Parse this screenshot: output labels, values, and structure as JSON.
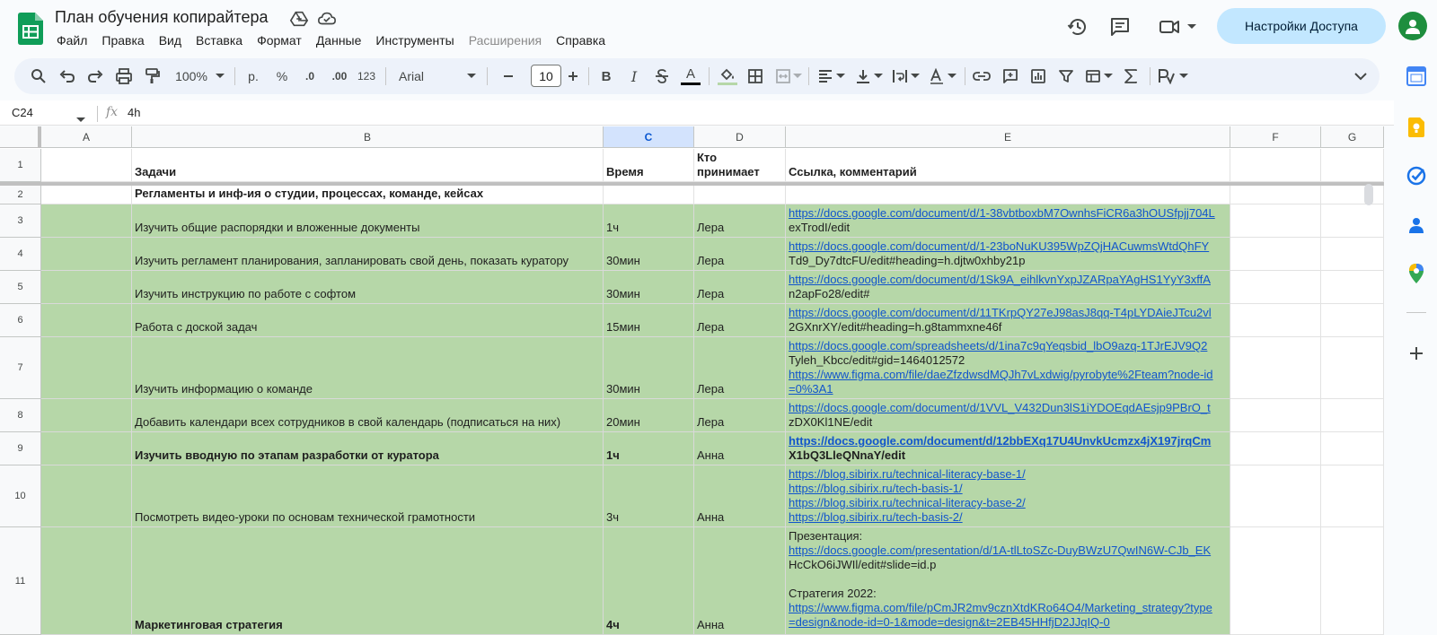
{
  "app": {
    "title": "План обучения копирайтера",
    "share_label": "Настройки Доступа",
    "accent": "#0f9d58"
  },
  "menu": [
    "Файл",
    "Правка",
    "Вид",
    "Вставка",
    "Формат",
    "Данные",
    "Инструменты",
    "Расширения",
    "Справка"
  ],
  "menu_disabled": [
    "Расширения"
  ],
  "toolbar": {
    "zoom": "100%",
    "currency": "р.",
    "percent": "%",
    "dec_decrease": ".0",
    "dec_increase": ".00",
    "format_num": "123",
    "font": "Arial",
    "font_size": "10",
    "bold": "B",
    "italic": "I",
    "text_color": "A"
  },
  "formula": {
    "cell_ref": "C24",
    "fx": "fx",
    "value": "4h"
  },
  "columns": [
    "A",
    "B",
    "C",
    "D",
    "E",
    "F",
    "G"
  ],
  "selected_column": "C",
  "rows": [
    {
      "num": "1",
      "green": false,
      "bold": true,
      "b": "Задачи",
      "c": "Время",
      "d": "Кто принимает",
      "e": [
        "Ссылка, комментарий"
      ],
      "e_link": false
    },
    {
      "num": "2",
      "green": false,
      "bold": true,
      "b": "Регламенты и инф-ия о студии, процессах, команде, кейсах",
      "c": "",
      "d": "",
      "e": [],
      "e_link": false
    },
    {
      "num": "3",
      "green": true,
      "bold": false,
      "b": "Изучить общие распорядки и вложенные документы",
      "c": "1ч",
      "d": "Лера",
      "e": [
        "https://docs.google.com/document/d/1-38vbtboxbM7OwnhsFiCR6a3hOUSfpjj704L",
        "exTrodI/edit"
      ],
      "e_link": true
    },
    {
      "num": "4",
      "green": true,
      "bold": false,
      "b": "Изучить регламент планирования, запланировать свой день, показать куратору",
      "c": "30мин",
      "d": "Лера",
      "e": [
        "https://docs.google.com/document/d/1-23boNuKU395WpZQjHACuwmsWtdQhFY",
        "Td9_Dy7dtcFU/edit#heading=h.djtw0xhby21p"
      ],
      "e_link": true
    },
    {
      "num": "5",
      "green": true,
      "bold": false,
      "b": "Изучить инструкцию по работе с софтом",
      "c": "30мин",
      "d": "Лера",
      "e": [
        "https://docs.google.com/document/d/1Sk9A_eihlkvnYxpJZARpaYAgHS1YyY3xffA",
        "n2apFo28/edit#"
      ],
      "e_link": true
    },
    {
      "num": "6",
      "green": true,
      "bold": false,
      "b": "Работа с доской задач",
      "c": "15мин",
      "d": "Лера",
      "e": [
        "https://docs.google.com/document/d/11TKrpQY27eJ98asJ8qq-T4pLYDAieJTcu2vl",
        "2GXnrXY/edit#heading=h.g8tammxne46f"
      ],
      "e_link": true
    },
    {
      "num": "7",
      "green": true,
      "bold": false,
      "b": "Изучить информацию о команде",
      "c": "30мин",
      "d": "Лера",
      "e": [
        "https://docs.google.com/spreadsheets/d/1ina7c9qYeqsbid_lbO9azq-1TJrEJV9Q2",
        "Tyleh_Kbcc/edit#gid=1464012572",
        "https://www.figma.com/file/daeZfzdwsdMQJh7vLxdwig/pyrobyte%2Fteam?node-id",
        "=0%3A1"
      ],
      "e_link": true
    },
    {
      "num": "8",
      "green": true,
      "bold": false,
      "b": "Добавить календари всех сотрудников в свой календарь (подписаться на них)",
      "c": "20мин",
      "d": "Лера",
      "e": [
        "https://docs.google.com/document/d/1VVL_V432Dun3lS1iYDOEqdAEsjp9PBrO_t",
        "zDX0Kl1NE/edit"
      ],
      "e_link": true
    },
    {
      "num": "9",
      "green": true,
      "bold": true,
      "b": "Изучить вводную по этапам разработки от куратора",
      "c": "1ч",
      "d": "Анна",
      "e": [
        "https://docs.google.com/document/d/12bbEXq17U4UnvkUcmzx4jX197jrqCm",
        "X1bQ3LleQNnaY/edit"
      ],
      "e_link": true
    },
    {
      "num": "10",
      "green": true,
      "bold": false,
      "b": "Посмотреть видео-уроки по основам технической грамотности",
      "c": "3ч",
      "d": "Анна",
      "e": [
        "https://blog.sibirix.ru/technical-literacy-base-1/",
        "https://blog.sibirix.ru/tech-basis-1/",
        "https://blog.sibirix.ru/technical-literacy-base-2/",
        "https://blog.sibirix.ru/tech-basis-2/"
      ],
      "e_link": true
    },
    {
      "num": "11",
      "green": true,
      "bold": true,
      "b": "Маркетинговая стратегия",
      "c": "4ч",
      "d": "Анна",
      "e": [
        "Презентация:",
        "https://docs.google.com/presentation/d/1A-tlLtoSZc-DuyBWzU7QwIN6W-CJb_EK",
        "HcCkO6iJWIl/edit#slide=id.p",
        "",
        "Стратегия 2022:",
        "https://www.figma.com/file/pCmJR2mv9cznXtdKRo64O4/Marketing_strategy?type",
        "=design&node-id=0-1&mode=design&t=2EB45HHfjD2JJqIQ-0"
      ],
      "e_link": true
    }
  ],
  "colors": {
    "green_fill": "#b6d7a8",
    "link": "#1155cc",
    "share_bg": "#c2e7ff",
    "selected_header": "#d3e3fd"
  }
}
